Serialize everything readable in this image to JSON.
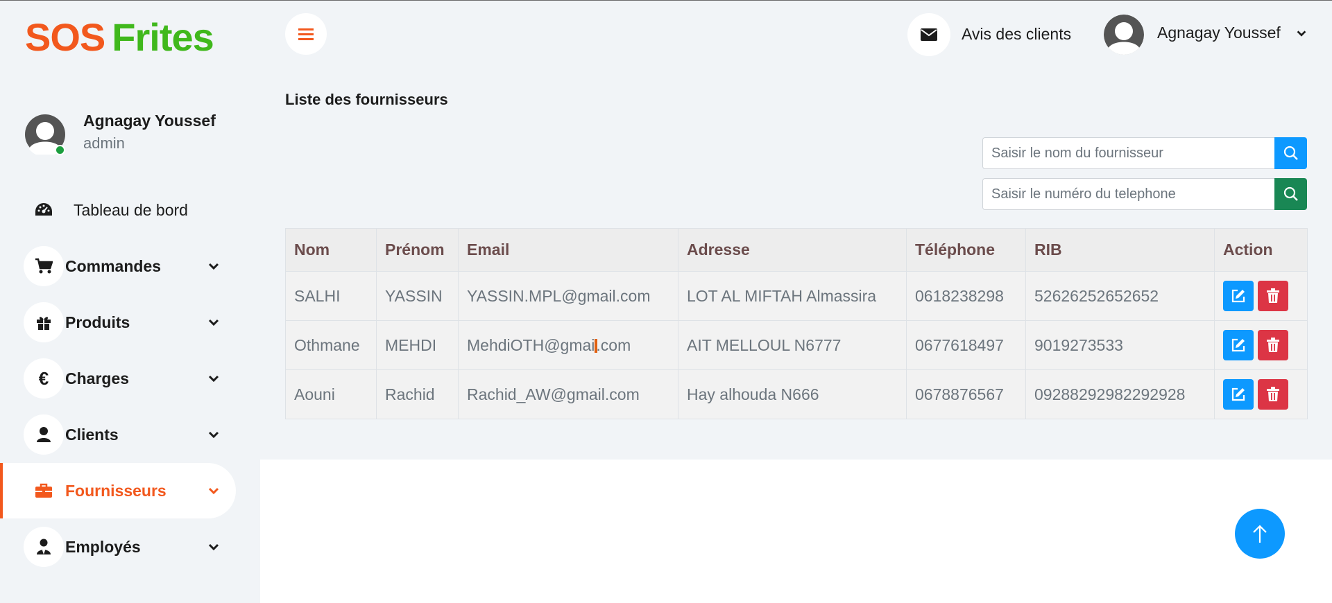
{
  "brand": {
    "part1": "SOS",
    "part2": "Frites",
    "color1": "#f2581d",
    "color2": "#40b81c"
  },
  "profile": {
    "name": "Agnagay Youssef",
    "role": "admin",
    "status_color": "#1b9e3e"
  },
  "sidebar": {
    "items": [
      {
        "label": "Tableau de bord",
        "icon": "dashboard-icon"
      },
      {
        "label": "Commandes",
        "icon": "cart-icon"
      },
      {
        "label": "Produits",
        "icon": "gift-icon"
      },
      {
        "label": "Charges",
        "icon": "euro-icon"
      },
      {
        "label": "Clients",
        "icon": "user-icon"
      },
      {
        "label": "Fournisseurs",
        "icon": "briefcase-icon",
        "active": true
      },
      {
        "label": "Employés",
        "icon": "user-tie-icon"
      }
    ]
  },
  "header": {
    "reviews_label": "Avis des clients",
    "user_name": "Agnagay Youssef"
  },
  "page": {
    "title": "Liste des fournisseurs",
    "search_name_placeholder": "Saisir le nom du fournisseur",
    "search_phone_placeholder": "Saisir le numéro du telephone"
  },
  "table": {
    "columns": [
      "Nom",
      "Prénom",
      "Email",
      "Adresse",
      "Téléphone",
      "RIB",
      "Action"
    ],
    "rows": [
      {
        "nom": "SALHI",
        "prenom": "YASSIN",
        "email": "YASSIN.MPL@gmail.com",
        "adresse": "LOT AL MIFTAH Almassira",
        "telephone": "0618238298",
        "rib": "52626252652652"
      },
      {
        "nom": "Othmane",
        "prenom": "MEHDI",
        "email_before": "MehdiOTH@gmai",
        "email_after": ".com",
        "adresse": "AIT MELLOUL N6777",
        "telephone": "0677618497",
        "rib": "9019273533"
      },
      {
        "nom": "Aouni",
        "prenom": "Rachid",
        "email": "Rachid_AW@gmail.com",
        "adresse": "Hay alhouda N666",
        "telephone": "0678876567",
        "rib": "09288292982292928"
      }
    ]
  },
  "colors": {
    "accent": "#f2581d",
    "primary": "#0d99ff",
    "success": "#198754",
    "danger": "#dc3545"
  }
}
